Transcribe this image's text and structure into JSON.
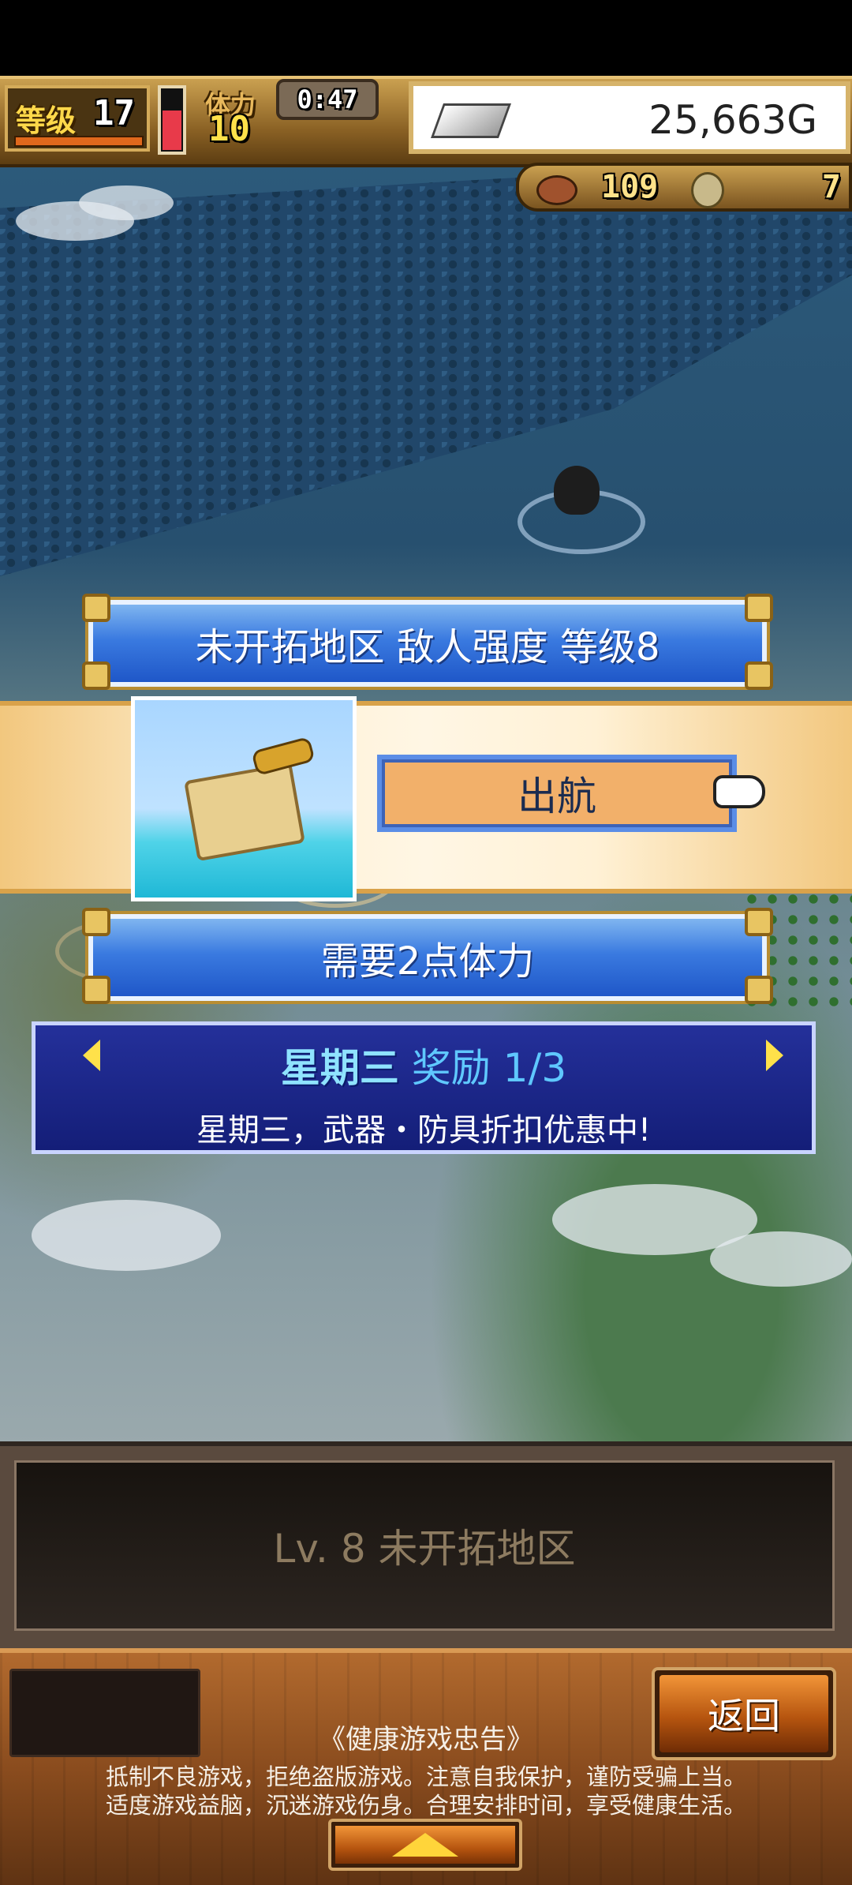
{
  "hud": {
    "level_label": "等级",
    "level_value": "17",
    "stamina_label": "体力",
    "stamina_value": "10",
    "timer": "0:47",
    "gold": "25,663G",
    "resource_a": "109",
    "resource_b": "7"
  },
  "popup": {
    "area_title": "未开拓地区  敌人强度 等级8",
    "sail_button": "出航",
    "cost_text": "需要2点体力"
  },
  "event": {
    "day": "星期三",
    "reward_label": "奖励 1/3",
    "description": "星期三，武器・防具折扣优惠中!"
  },
  "info_panel": {
    "text": "Lv. 8 未开拓地区"
  },
  "footer": {
    "back_button": "返回",
    "notice_title": "《健康游戏忠告》",
    "notice_line1": "抵制不良游戏，拒绝盗版游戏。注意自我保护，谨防受骗上当。",
    "notice_line2": "适度游戏益脑，沉迷游戏伤身。合理安排时间，享受健康生活。"
  },
  "icons": {
    "silver_bar": "silver-bar-icon",
    "meat": "meat-icon",
    "coin": "coin-icon",
    "pointer": "hand-pointer-icon"
  },
  "colors": {
    "banner_blue": "#3a7ae0",
    "event_navy": "#141e78",
    "sail_orange": "#f2b06a",
    "footer_brown": "#8a4c1e"
  }
}
